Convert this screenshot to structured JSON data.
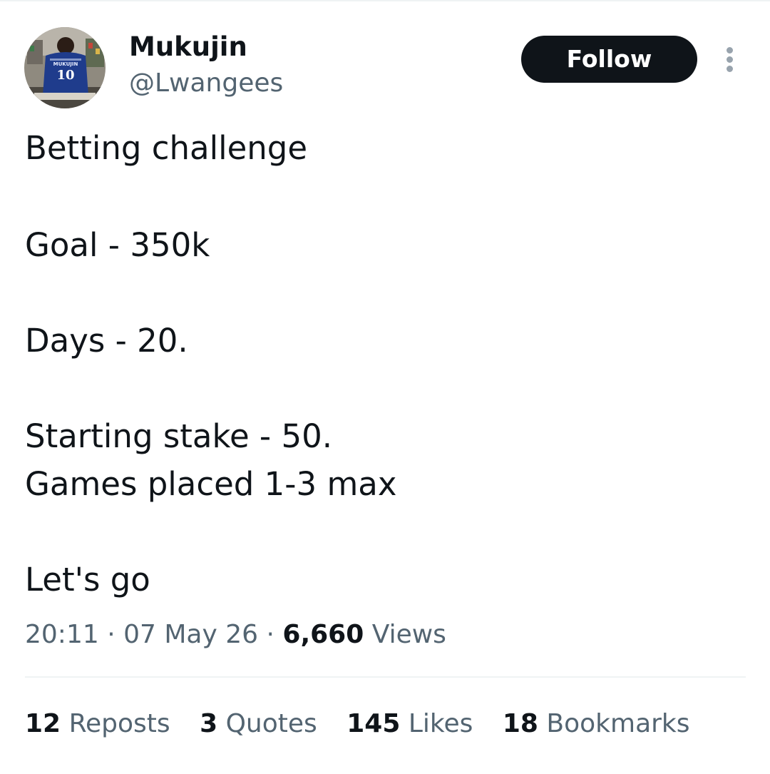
{
  "user": {
    "display_name": "Mukujin",
    "handle": "@Lwangees",
    "avatar": {
      "jersey_name": "MUKUJIN",
      "jersey_number": "10"
    }
  },
  "follow_label": "Follow",
  "more_icon": "more-vertical-icon",
  "tweet": {
    "lines": [
      "Betting challenge",
      "Goal - 350k",
      "Days - 20.",
      "Starting stake - 50.",
      "Games placed  1-3 max",
      "Let's go"
    ]
  },
  "meta": {
    "time": "20:11",
    "separator": "·",
    "date": "07 May 26",
    "views_count": "6,660",
    "views_label": "Views"
  },
  "stats": {
    "reposts_count": "12",
    "reposts_label": "Reposts",
    "quotes_count": "3",
    "quotes_label": "Quotes",
    "likes_count": "145",
    "likes_label": "Likes",
    "bookmarks_count": "18",
    "bookmarks_label": "Bookmarks"
  },
  "colors": {
    "text_primary": "#0f1419",
    "text_secondary": "#536471",
    "follow_bg": "#0f1419",
    "divider": "#eff3f4",
    "jersey_blue": "#1f3c8c"
  }
}
